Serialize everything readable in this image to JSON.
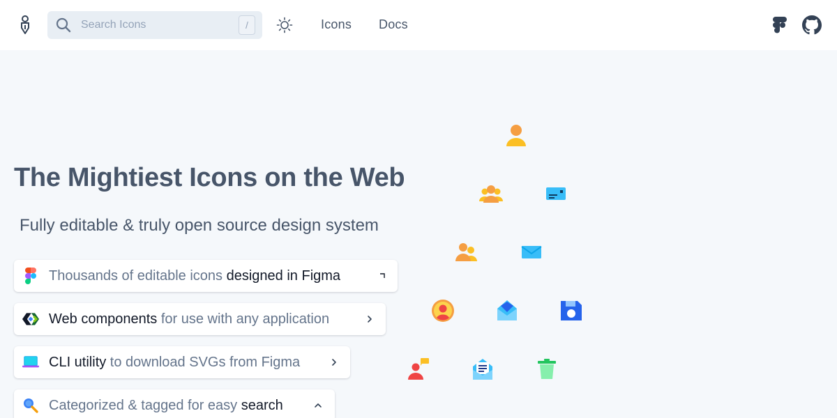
{
  "header": {
    "search_placeholder": "Search Icons",
    "search_shortcut": "/",
    "nav": [
      {
        "label": "Icons"
      },
      {
        "label": "Docs"
      }
    ],
    "icons": [
      "logo-icon",
      "search-icon",
      "sun-icon",
      "figma-icon",
      "github-icon"
    ]
  },
  "hero": {
    "title": "The Mightiest Icons on the Web",
    "subtitle": "Fully editable & truly open source design system"
  },
  "features": [
    {
      "icon": "figma-icon",
      "text_a": "Thousands of editable icons ",
      "text_b": "designed in Figma",
      "text_c": ""
    },
    {
      "icon": "web-components-icon",
      "text_a": "",
      "text_b": "Web components",
      "text_c": " for use with any application"
    },
    {
      "icon": "laptop-icon",
      "text_a": "",
      "text_b": "CLI utility",
      "text_c": " to download SVGs from Figma"
    },
    {
      "icon": "magnifier-icon",
      "text_a": "Categorized & tagged for easy ",
      "text_b": "search",
      "text_c": ""
    }
  ],
  "icon_cloud": [
    "user-icon",
    "users-group-icon",
    "id-card-icon",
    "users-icon",
    "mail-icon",
    "user-circle-icon",
    "mail-open-icon",
    "floppy-disk-icon",
    "user-chat-icon",
    "mail-document-icon",
    "trash-icon"
  ],
  "colors": {
    "background": "#f5f8fb",
    "header": "#ffffff",
    "search_bg": "#e8eef4",
    "title": "#475569",
    "accent_orange": "#f59e42",
    "accent_blue": "#3b9fe8"
  }
}
